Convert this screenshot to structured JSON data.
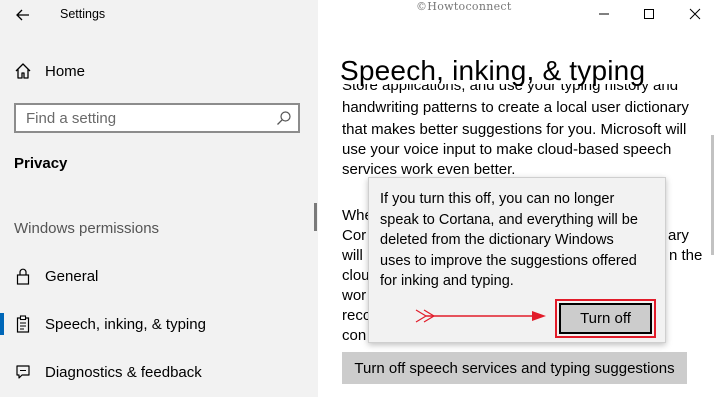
{
  "app_title": "Settings",
  "watermark": "©Howtoconnect",
  "sidebar": {
    "home_label": "Home",
    "search_placeholder": "Find a setting",
    "category": "Privacy",
    "section_heading": "Windows permissions",
    "items": [
      {
        "label": "General"
      },
      {
        "label": "Speech, inking, & typing"
      },
      {
        "label": "Diagnostics & feedback"
      }
    ]
  },
  "main": {
    "title": "Speech, inking, & typing",
    "paragraph_top_clipped": "Store applications, and use your typing history and",
    "paragraph_lines": [
      "handwriting patterns to create a local user dictionary",
      "that makes better suggestions for you. Microsoft will",
      "use your voice input to make cloud-based speech",
      "services work even better."
    ],
    "second_paragraph_visible": [
      {
        "left": "Whe",
        "right": ""
      },
      {
        "left": "Cor",
        "right": "ary"
      },
      {
        "left": "will",
        "right": "n the"
      },
      {
        "left": "clou",
        "right": ""
      },
      {
        "left": "wor",
        "right": ""
      },
      {
        "left": "reco",
        "right": ""
      },
      {
        "left": "con",
        "right": ""
      }
    ],
    "turn_off_services_button": "Turn off speech services and typing suggestions"
  },
  "flyout": {
    "lines": [
      "If you turn this off, you can no longer",
      "speak to Cortana, and everything will be",
      "deleted from the dictionary Windows",
      "uses to improve the suggestions offered",
      "for inking and typing."
    ],
    "turn_off_label": "Turn off"
  },
  "colors": {
    "sidebar_bg": "#f2f2f2",
    "selection_accent": "#0067b8",
    "highlight_red": "#e21c2a",
    "button_gray": "#cccccc"
  },
  "icons": [
    "back-arrow-icon",
    "home-icon",
    "search-icon",
    "lock-icon",
    "clipboard-icon",
    "feedback-icon",
    "minimize-icon",
    "maximize-icon",
    "close-icon"
  ]
}
